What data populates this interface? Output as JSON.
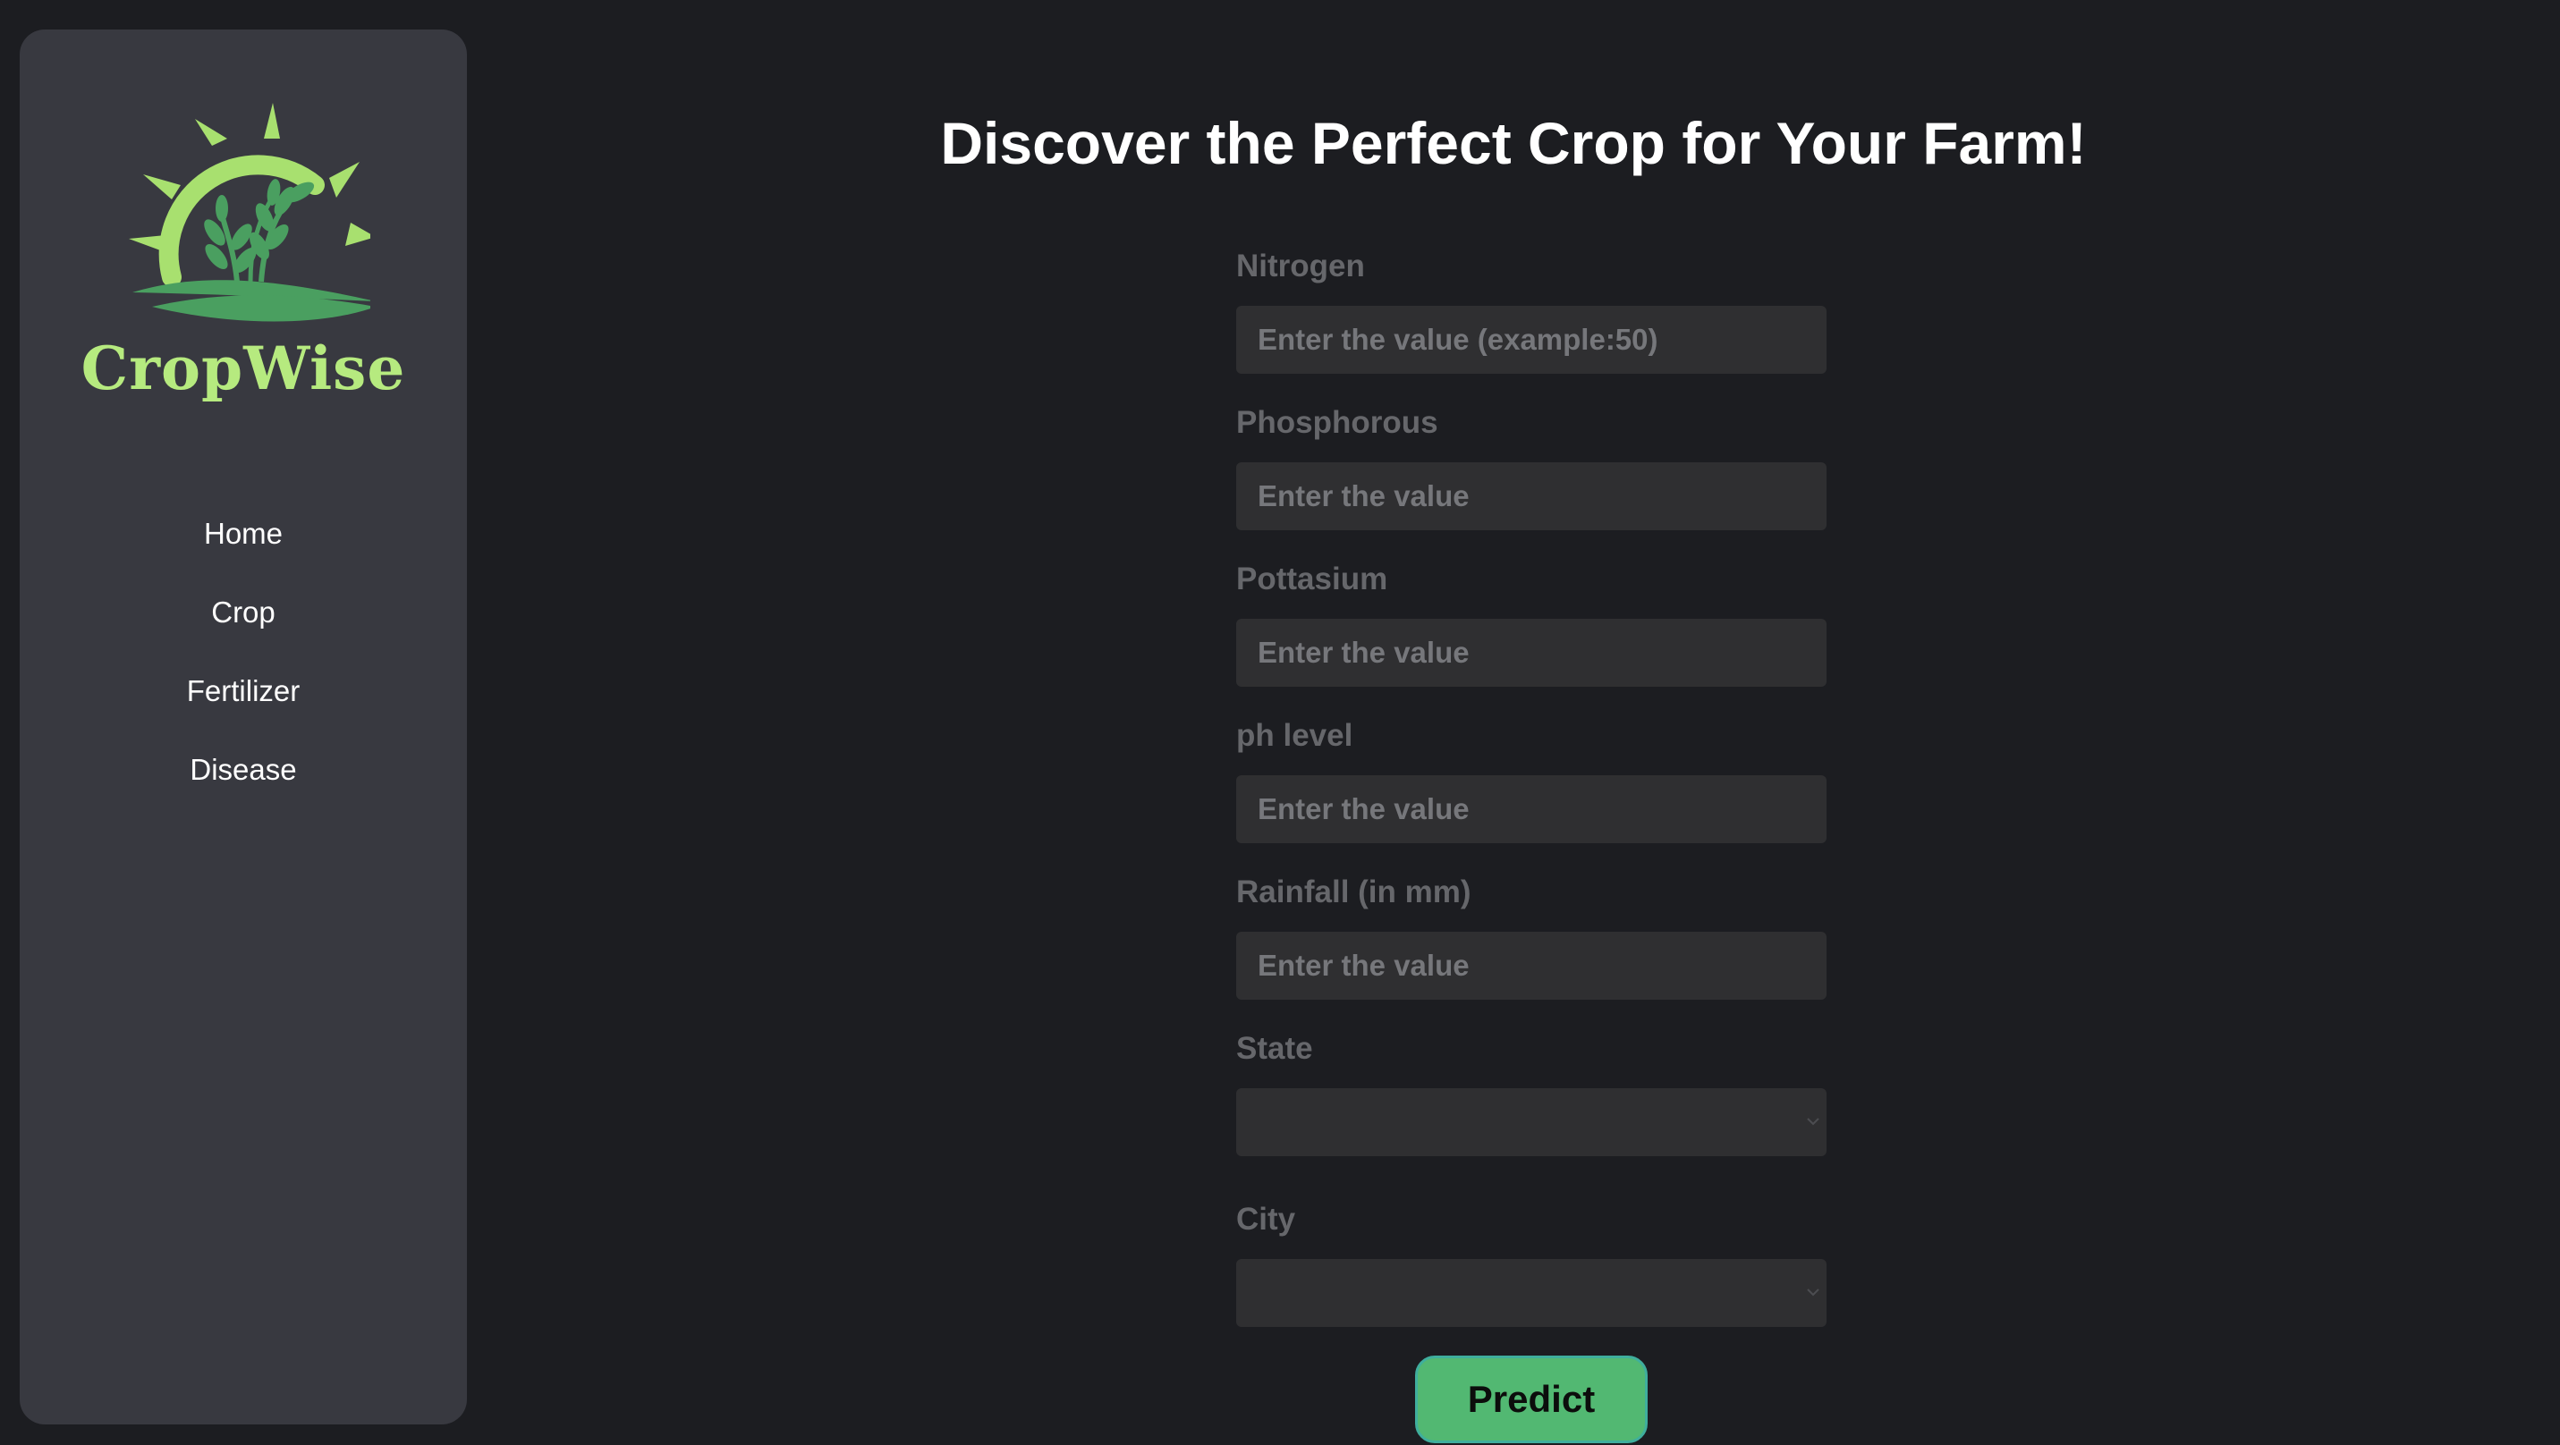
{
  "brand": {
    "name": "CropWise",
    "logo_color": "#b6ea7f",
    "leaf_color": "#4a9f60"
  },
  "nav": {
    "items": [
      {
        "label": "Home"
      },
      {
        "label": "Crop"
      },
      {
        "label": "Fertilizer"
      },
      {
        "label": "Disease"
      }
    ]
  },
  "page": {
    "title": "Discover the Perfect Crop for Your Farm!"
  },
  "form": {
    "nitrogen": {
      "label": "Nitrogen",
      "placeholder": "Enter the value (example:50)",
      "value": ""
    },
    "phosphorous": {
      "label": "Phosphorous",
      "placeholder": "Enter the value",
      "value": ""
    },
    "pottasium": {
      "label": "Pottasium",
      "placeholder": "Enter the value",
      "value": ""
    },
    "ph": {
      "label": "ph level",
      "placeholder": "Enter the value",
      "value": ""
    },
    "rainfall": {
      "label": "Rainfall (in mm)",
      "placeholder": "Enter the value",
      "value": ""
    },
    "state": {
      "label": "State",
      "selected": ""
    },
    "city": {
      "label": "City",
      "selected": ""
    },
    "submit_label": "Predict"
  },
  "colors": {
    "background": "#1c1d21",
    "sidebar": "#383940",
    "input": "#2f2f31",
    "accent": "#52b872"
  }
}
